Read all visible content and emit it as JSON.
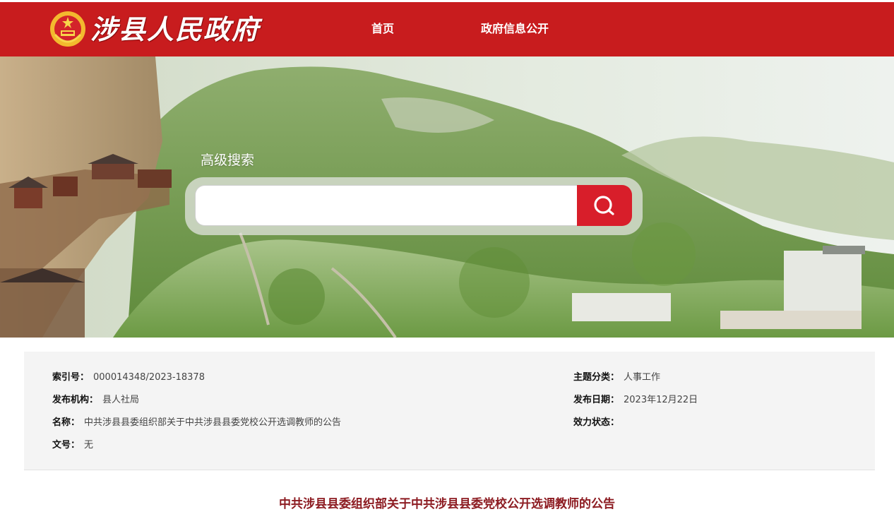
{
  "header": {
    "site_title": "涉县人民政府",
    "nav": [
      {
        "label": "首页"
      },
      {
        "label": "政府信息公开"
      }
    ]
  },
  "search": {
    "title": "高级搜索",
    "placeholder": "",
    "value": ""
  },
  "meta": {
    "index_no": {
      "label": "索引号：",
      "value": "000014348/2023-18378"
    },
    "agency": {
      "label": "发布机构：",
      "value": "县人社局"
    },
    "name": {
      "label": "名称：",
      "value": "中共涉县县委组织部关于中共涉县县委党校公开选调教师的公告"
    },
    "doc_no": {
      "label": "文号：",
      "value": "无"
    },
    "category": {
      "label": "主题分类：",
      "value": "人事工作"
    },
    "date": {
      "label": "发布日期：",
      "value": "2023年12月22日"
    },
    "status": {
      "label": "效力状态：",
      "value": ""
    }
  },
  "article": {
    "title": "中共涉县县委组织部关于中共涉县县委党校公开选调教师的公告"
  },
  "colors": {
    "header_red": "#c81c1e",
    "search_red": "#d81e2a",
    "title_red": "#8d1c22"
  }
}
